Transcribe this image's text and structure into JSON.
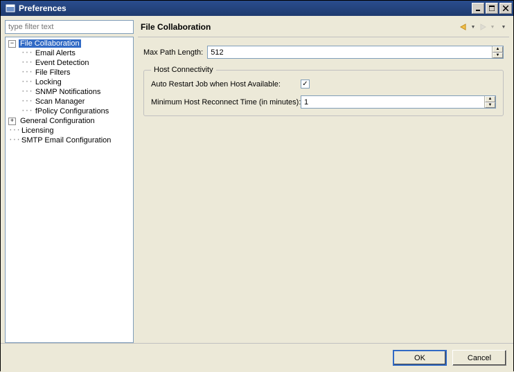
{
  "window": {
    "title": "Preferences",
    "icon": "app-icon"
  },
  "filter": {
    "placeholder": "type filter text"
  },
  "tree": {
    "nodes": [
      {
        "label": "File Collaboration",
        "level": 0,
        "expanded": true,
        "selected": true
      },
      {
        "label": "Email Alerts",
        "level": 1
      },
      {
        "label": "Event Detection",
        "level": 1
      },
      {
        "label": "File Filters",
        "level": 1
      },
      {
        "label": "Locking",
        "level": 1
      },
      {
        "label": "SNMP Notifications",
        "level": 1
      },
      {
        "label": "Scan Manager",
        "level": 1
      },
      {
        "label": "fPolicy Configurations",
        "level": 1
      },
      {
        "label": "General Configuration",
        "level": 0,
        "expanded": false
      },
      {
        "label": "Licensing",
        "level": 0
      },
      {
        "label": "SMTP Email Configuration",
        "level": 0
      }
    ]
  },
  "page": {
    "title": "File Collaboration",
    "maxPathLabel": "Max Path Length:",
    "maxPathValue": "512",
    "hostConnectivity": {
      "legend": "Host Connectivity",
      "autoRestartLabel": "Auto Restart Job when Host Available:",
      "autoRestartChecked": true,
      "minReconnectLabel": "Minimum Host Reconnect Time (in minutes):",
      "minReconnectValue": "1"
    }
  },
  "buttons": {
    "ok": "OK",
    "cancel": "Cancel"
  }
}
